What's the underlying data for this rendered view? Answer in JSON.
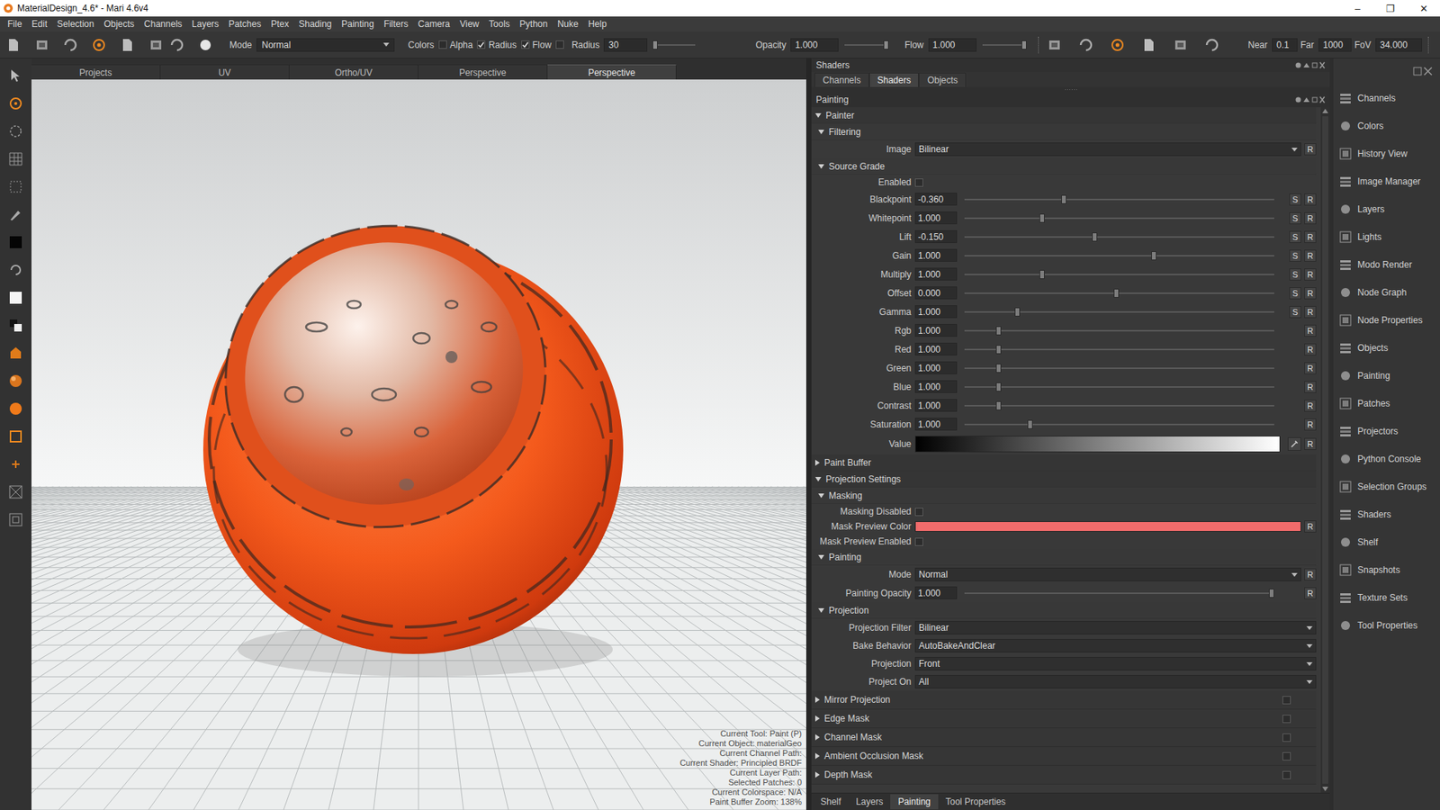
{
  "window": {
    "title": "MaterialDesign_4.6* - Mari 4.6v4",
    "controls": [
      "–",
      "❐",
      "✕"
    ]
  },
  "menu": [
    "File",
    "Edit",
    "Selection",
    "Objects",
    "Channels",
    "Layers",
    "Patches",
    "Ptex",
    "Shading",
    "Painting",
    "Filters",
    "Camera",
    "View",
    "Tools",
    "Python",
    "Nuke",
    "Help"
  ],
  "toolbar": {
    "mode": {
      "label": "Mode",
      "value": "Normal"
    },
    "toggles": [
      {
        "label": "Colors",
        "checked": false
      },
      {
        "label": "Alpha",
        "checked": true
      },
      {
        "label": "Radius",
        "checked": true
      },
      {
        "label": "Flow",
        "checked": false
      }
    ],
    "fields": [
      {
        "label": "Radius",
        "value": "30",
        "level": 0.05
      },
      {
        "label": "Opacity",
        "value": "1.000",
        "level": 1
      },
      {
        "label": "Flow",
        "value": "1.000",
        "level": 1
      }
    ],
    "camera": [
      {
        "label": "Near",
        "value": "0.1"
      },
      {
        "label": "Far",
        "value": "1000"
      },
      {
        "label": "FoV",
        "value": "34.000"
      }
    ]
  },
  "viewport": {
    "tabs": [
      {
        "label": "Projects",
        "selected": false
      },
      {
        "label": "UV",
        "selected": false
      },
      {
        "label": "Ortho/UV",
        "selected": false
      },
      {
        "label": "Perspective",
        "selected": false
      },
      {
        "label": "Perspective",
        "selected": true
      }
    ],
    "status": [
      "Current Tool: Paint (P)",
      "Current Object: materialGeo",
      "Current Channel Path:",
      "Current Shader: Principled BRDF",
      "Current Layer Path:",
      "Selected Patches: 0",
      "Current Colorspace: N/A",
      "Paint Buffer Zoom: 138%"
    ]
  },
  "shaders_panel": {
    "title": "Shaders",
    "tabs": [
      {
        "label": "Channels",
        "selected": false
      },
      {
        "label": "Shaders",
        "selected": true
      },
      {
        "label": "Objects",
        "selected": false
      }
    ]
  },
  "painting_panel": {
    "title": "Painting",
    "rows": [
      {
        "kind": "section",
        "label": "Painter",
        "depth": 0,
        "expanded": true
      },
      {
        "kind": "section",
        "label": "Filtering",
        "depth": 1,
        "expanded": true
      },
      {
        "kind": "dropdown",
        "label": "Image",
        "value": "Bilinear",
        "buttons": [
          "R"
        ]
      },
      {
        "kind": "section",
        "label": "Source Grade",
        "depth": 1,
        "expanded": true
      },
      {
        "kind": "checkbox",
        "label": "Enabled",
        "checked": false
      },
      {
        "kind": "slider",
        "label": "Blackpoint",
        "value": "-0.360",
        "level": 0.32,
        "buttons": [
          "S",
          "R"
        ]
      },
      {
        "kind": "slider",
        "label": "Whitepoint",
        "value": "1.000",
        "level": 0.25,
        "buttons": [
          "S",
          "R"
        ]
      },
      {
        "kind": "slider",
        "label": "Lift",
        "value": "-0.150",
        "level": 0.42,
        "buttons": [
          "S",
          "R"
        ]
      },
      {
        "kind": "slider",
        "label": "Gain",
        "value": "1.000",
        "level": 0.61,
        "buttons": [
          "S",
          "R"
        ]
      },
      {
        "kind": "slider",
        "label": "Multiply",
        "value": "1.000",
        "level": 0.25,
        "buttons": [
          "S",
          "R"
        ]
      },
      {
        "kind": "slider",
        "label": "Offset",
        "value": "0.000",
        "level": 0.49,
        "buttons": [
          "S",
          "R"
        ]
      },
      {
        "kind": "slider",
        "label": "Gamma",
        "value": "1.000",
        "level": 0.17,
        "buttons": [
          "S",
          "R"
        ]
      },
      {
        "kind": "slider",
        "label": "Rgb",
        "value": "1.000",
        "level": 0.11,
        "buttons": [
          "R"
        ]
      },
      {
        "kind": "slider",
        "label": "Red",
        "value": "1.000",
        "level": 0.11,
        "buttons": [
          "R"
        ]
      },
      {
        "kind": "slider",
        "label": "Green",
        "value": "1.000",
        "level": 0.11,
        "buttons": [
          "R"
        ]
      },
      {
        "kind": "slider",
        "label": "Blue",
        "value": "1.000",
        "level": 0.11,
        "buttons": [
          "R"
        ]
      },
      {
        "kind": "slider",
        "label": "Contrast",
        "value": "1.000",
        "level": 0.11,
        "buttons": [
          "R"
        ]
      },
      {
        "kind": "slider",
        "label": "Saturation",
        "value": "1.000",
        "level": 0.21,
        "buttons": [
          "R"
        ]
      },
      {
        "kind": "gradient",
        "label": "Value",
        "buttons": [
          "R"
        ]
      },
      {
        "kind": "section",
        "label": "Paint Buffer",
        "depth": 0,
        "expanded": false
      },
      {
        "kind": "section",
        "label": "Projection Settings",
        "depth": 0,
        "expanded": true
      },
      {
        "kind": "section",
        "label": "Masking",
        "depth": 1,
        "expanded": true
      },
      {
        "kind": "checkbox",
        "label": "Masking Disabled",
        "checked": false
      },
      {
        "kind": "color",
        "label": "Mask Preview Color",
        "color": "#f26b6b",
        "buttons": [
          "R"
        ]
      },
      {
        "kind": "checkbox",
        "label": "Mask Preview Enabled",
        "checked": false
      },
      {
        "kind": "section",
        "label": "Painting",
        "depth": 1,
        "expanded": true
      },
      {
        "kind": "dropdown",
        "label": "Mode",
        "value": "Normal",
        "buttons": [
          "R"
        ]
      },
      {
        "kind": "slider",
        "label": "Painting Opacity",
        "value": "1.000",
        "level": 0.99,
        "buttons": [
          "R"
        ]
      },
      {
        "kind": "section",
        "label": "Projection",
        "depth": 1,
        "expanded": true
      },
      {
        "kind": "dropdown",
        "label": "Projection Filter",
        "value": "Bilinear",
        "buttons": []
      },
      {
        "kind": "dropdown",
        "label": "Bake Behavior",
        "value": "AutoBakeAndClear",
        "buttons": []
      },
      {
        "kind": "dropdown",
        "label": "Projection",
        "value": "Front",
        "buttons": []
      },
      {
        "kind": "dropdown",
        "label": "Project On",
        "value": "All",
        "buttons": []
      },
      {
        "kind": "mask",
        "label": "Mirror Projection",
        "expanded": false,
        "checked": false
      },
      {
        "kind": "mask",
        "label": "Edge Mask",
        "expanded": false,
        "checked": false
      },
      {
        "kind": "mask",
        "label": "Channel Mask",
        "expanded": false,
        "checked": false
      },
      {
        "kind": "mask",
        "label": "Ambient Occlusion Mask",
        "expanded": false,
        "checked": false
      },
      {
        "kind": "mask",
        "label": "Depth Mask",
        "expanded": false,
        "checked": false
      }
    ]
  },
  "bottom_tabs": [
    {
      "label": "Shelf",
      "selected": false
    },
    {
      "label": "Layers",
      "selected": false
    },
    {
      "label": "Painting",
      "selected": true
    },
    {
      "label": "Tool Properties",
      "selected": false
    }
  ],
  "palettes": [
    "Channels",
    "Colors",
    "History View",
    "Image Manager",
    "Layers",
    "Lights",
    "Modo Render",
    "Node Graph",
    "Node Properties",
    "Objects",
    "Painting",
    "Patches",
    "Projectors",
    "Python Console",
    "Selection Groups",
    "Shaders",
    "Shelf",
    "Snapshots",
    "Texture Sets",
    "Tool Properties"
  ]
}
